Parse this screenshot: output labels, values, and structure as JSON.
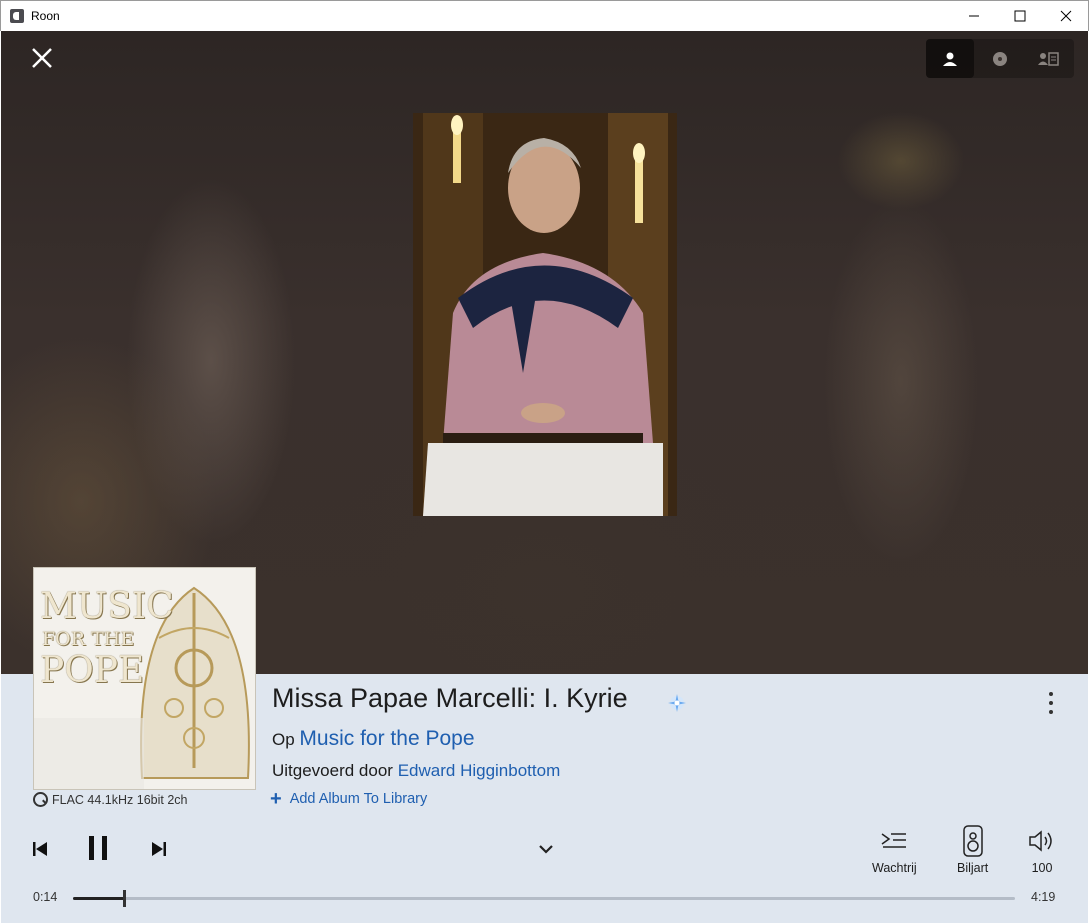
{
  "window": {
    "title": "Roon"
  },
  "view_tabs": [
    "artist",
    "album",
    "credits"
  ],
  "track": {
    "title": "Missa Papae Marcelli: I. Kyrie",
    "on_prefix": "Op",
    "album": "Music for the Pope",
    "performed_prefix": "Uitgevoerd door",
    "artist": "Edward Higginbottom",
    "add_to_library": "Add Album To Library",
    "format": "FLAC 44.1kHz 16bit 2ch"
  },
  "album_art": {
    "line1": "MUSIC",
    "line2": "FOR THE",
    "line3": "POPE"
  },
  "controls": {
    "queue_label": "Wachtrij",
    "zone_label": "Biljart",
    "volume": "100"
  },
  "progress": {
    "elapsed": "0:14",
    "total": "4:19",
    "fraction": 0.054
  },
  "colors": {
    "link": "#1f5fb0",
    "panel": "#dfe6ef"
  }
}
